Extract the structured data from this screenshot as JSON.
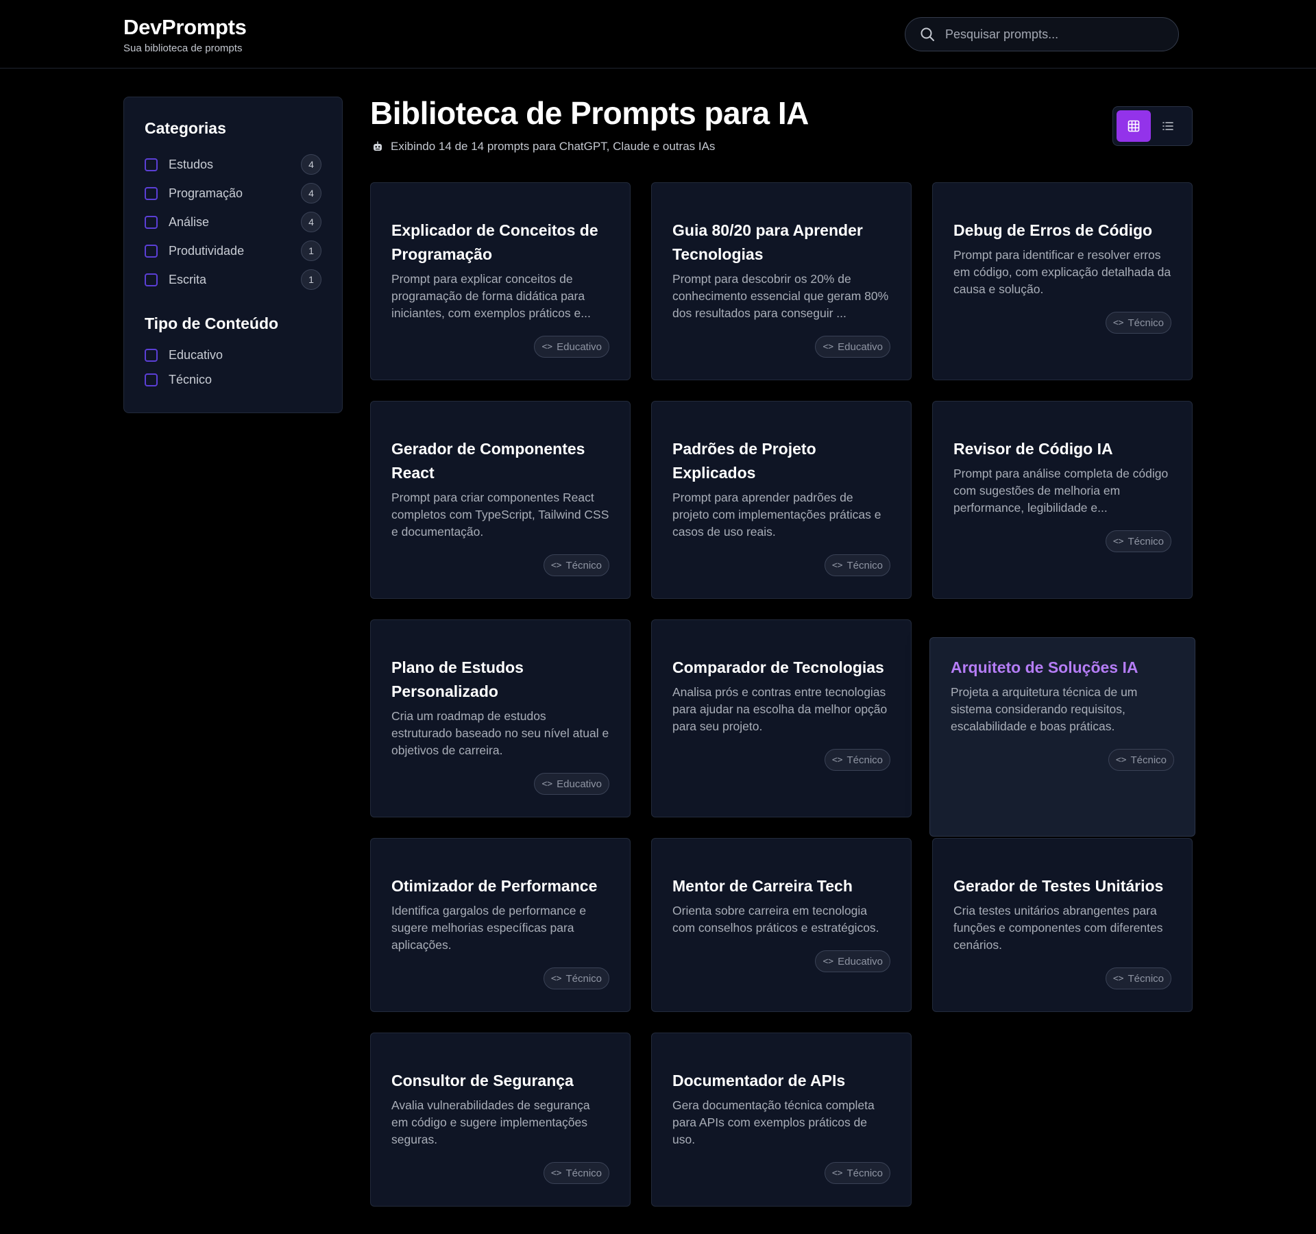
{
  "header": {
    "brand": "DevPrompts",
    "tagline": "Sua biblioteca de prompts",
    "search_placeholder": "Pesquisar prompts..."
  },
  "sidebar": {
    "categories_title": "Categorias",
    "categories": [
      {
        "label": "Estudos",
        "count": "4"
      },
      {
        "label": "Programação",
        "count": "4"
      },
      {
        "label": "Análise",
        "count": "4"
      },
      {
        "label": "Produtividade",
        "count": "1"
      },
      {
        "label": "Escrita",
        "count": "1"
      }
    ],
    "types_title": "Tipo de Conteúdo",
    "types": [
      {
        "label": "Educativo"
      },
      {
        "label": "Técnico"
      }
    ]
  },
  "main": {
    "title": "Biblioteca de Prompts para IA",
    "subtitle": "Exibindo 14 de 14 prompts para ChatGPT, Claude e outras IAs",
    "view_mode": "grid"
  },
  "cards": [
    {
      "title": "Explicador de Conceitos de Programação",
      "desc": "Prompt para explicar conceitos de programação de forma didática para iniciantes, com exemplos práticos e...",
      "tag": "Educativo"
    },
    {
      "title": "Guia 80/20 para Aprender Tecnologias",
      "desc": "Prompt para descobrir os 20% de conhecimento essencial que geram 80% dos resultados para conseguir ...",
      "tag": "Educativo"
    },
    {
      "title": "Debug de Erros de Código",
      "desc": "Prompt para identificar e resolver erros em código, com explicação detalhada da causa e solução.",
      "tag": "Técnico"
    },
    {
      "title": "Gerador de Componentes React",
      "desc": "Prompt para criar componentes React completos com TypeScript, Tailwind CSS e documentação.",
      "tag": "Técnico"
    },
    {
      "title": "Padrões de Projeto Explicados",
      "desc": "Prompt para aprender padrões de projeto com implementações práticas e casos de uso reais.",
      "tag": "Técnico"
    },
    {
      "title": "Revisor de Código IA",
      "desc": "Prompt para análise completa de código com sugestões de melhoria em performance, legibilidade e...",
      "tag": "Técnico"
    },
    {
      "title": "Plano de Estudos Personalizado",
      "desc": "Cria um roadmap de estudos estruturado baseado no seu nível atual e objetivos de carreira.",
      "tag": "Educativo"
    },
    {
      "title": "Comparador de Tecnologias",
      "desc": "Analisa prós e contras entre tecnologias para ajudar na escolha da melhor opção para seu projeto.",
      "tag": "Técnico"
    },
    {
      "title": "Arquiteto de Soluções IA",
      "desc": "Projeta a arquitetura técnica de um sistema considerando requisitos, escalabilidade e boas práticas.",
      "tag": "Técnico"
    },
    {
      "title": "Otimizador de Performance",
      "desc": "Identifica gargalos de performance e sugere melhorias específicas para aplicações.",
      "tag": "Técnico"
    },
    {
      "title": "Mentor de Carreira Tech",
      "desc": "Orienta sobre carreira em tecnologia com conselhos práticos e estratégicos.",
      "tag": "Educativo"
    },
    {
      "title": "Gerador de Testes Unitários",
      "desc": "Cria testes unitários abrangentes para funções e componentes com diferentes cenários.",
      "tag": "Técnico"
    },
    {
      "title": "Consultor de Segurança",
      "desc": "Avalia vulnerabilidades de segurança em código e sugere implementações seguras.",
      "tag": "Técnico"
    },
    {
      "title": "Documentador de APIs",
      "desc": "Gera documentação técnica completa para APIs com exemplos práticos de uso.",
      "tag": "Técnico"
    }
  ],
  "colors": {
    "accent": "#9333ea",
    "hover_title": "#b57df6",
    "card_bg": "#0f1525",
    "page_bg": "#000000"
  }
}
